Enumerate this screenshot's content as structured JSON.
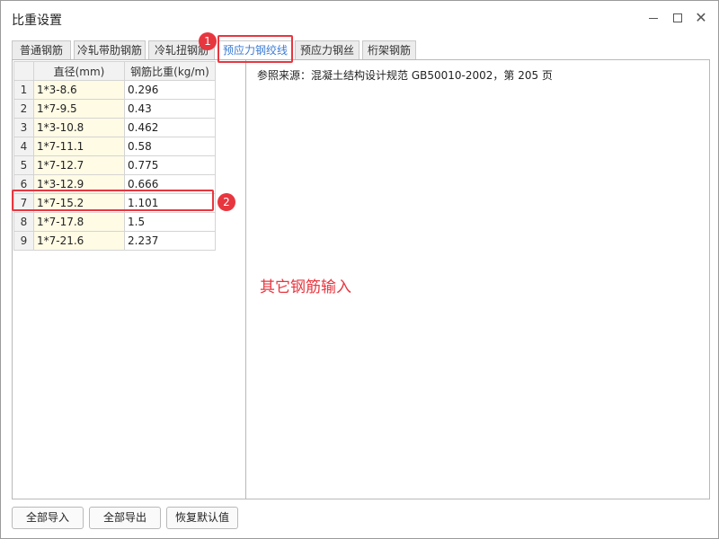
{
  "window": {
    "title": "比重设置",
    "controls": {
      "minimize": "minimize-icon",
      "maximize": "maximize-icon",
      "close": "close-icon"
    }
  },
  "tabs": [
    {
      "label": "普通钢筋"
    },
    {
      "label": "冷轧带肋钢筋"
    },
    {
      "label": "冷轧扭钢筋"
    },
    {
      "label": "预应力钢绞线",
      "active": true
    },
    {
      "label": "预应力钢丝"
    },
    {
      "label": "桁架钢筋"
    }
  ],
  "table": {
    "columns": [
      "直径(mm)",
      "钢筋比重(kg/m)"
    ],
    "rows": [
      {
        "num": "1",
        "diameter": "1*3-8.6",
        "weight": "0.296"
      },
      {
        "num": "2",
        "diameter": "1*7-9.5",
        "weight": "0.43"
      },
      {
        "num": "3",
        "diameter": "1*3-10.8",
        "weight": "0.462"
      },
      {
        "num": "4",
        "diameter": "1*7-11.1",
        "weight": "0.58"
      },
      {
        "num": "5",
        "diameter": "1*7-12.7",
        "weight": "0.775"
      },
      {
        "num": "6",
        "diameter": "1*3-12.9",
        "weight": "0.666"
      },
      {
        "num": "7",
        "diameter": "1*7-15.2",
        "weight": "1.101"
      },
      {
        "num": "8",
        "diameter": "1*7-17.8",
        "weight": "1.5"
      },
      {
        "num": "9",
        "diameter": "1*7-21.6",
        "weight": "2.237"
      }
    ]
  },
  "reference_text": "参照来源：混凝土结构设计规范 GB50010-2002，第 205 页",
  "other_input_label": "其它钢筋输入",
  "annotations": {
    "badge_1": "1",
    "badge_2": "2"
  },
  "buttons": {
    "import_all": "全部导入",
    "export_all": "全部导出",
    "restore_defaults": "恢复默认值"
  },
  "colors": {
    "accent": "#3a7bd5",
    "highlight": "#e8363f",
    "diameter_cell_bg": "#fffbe5"
  }
}
